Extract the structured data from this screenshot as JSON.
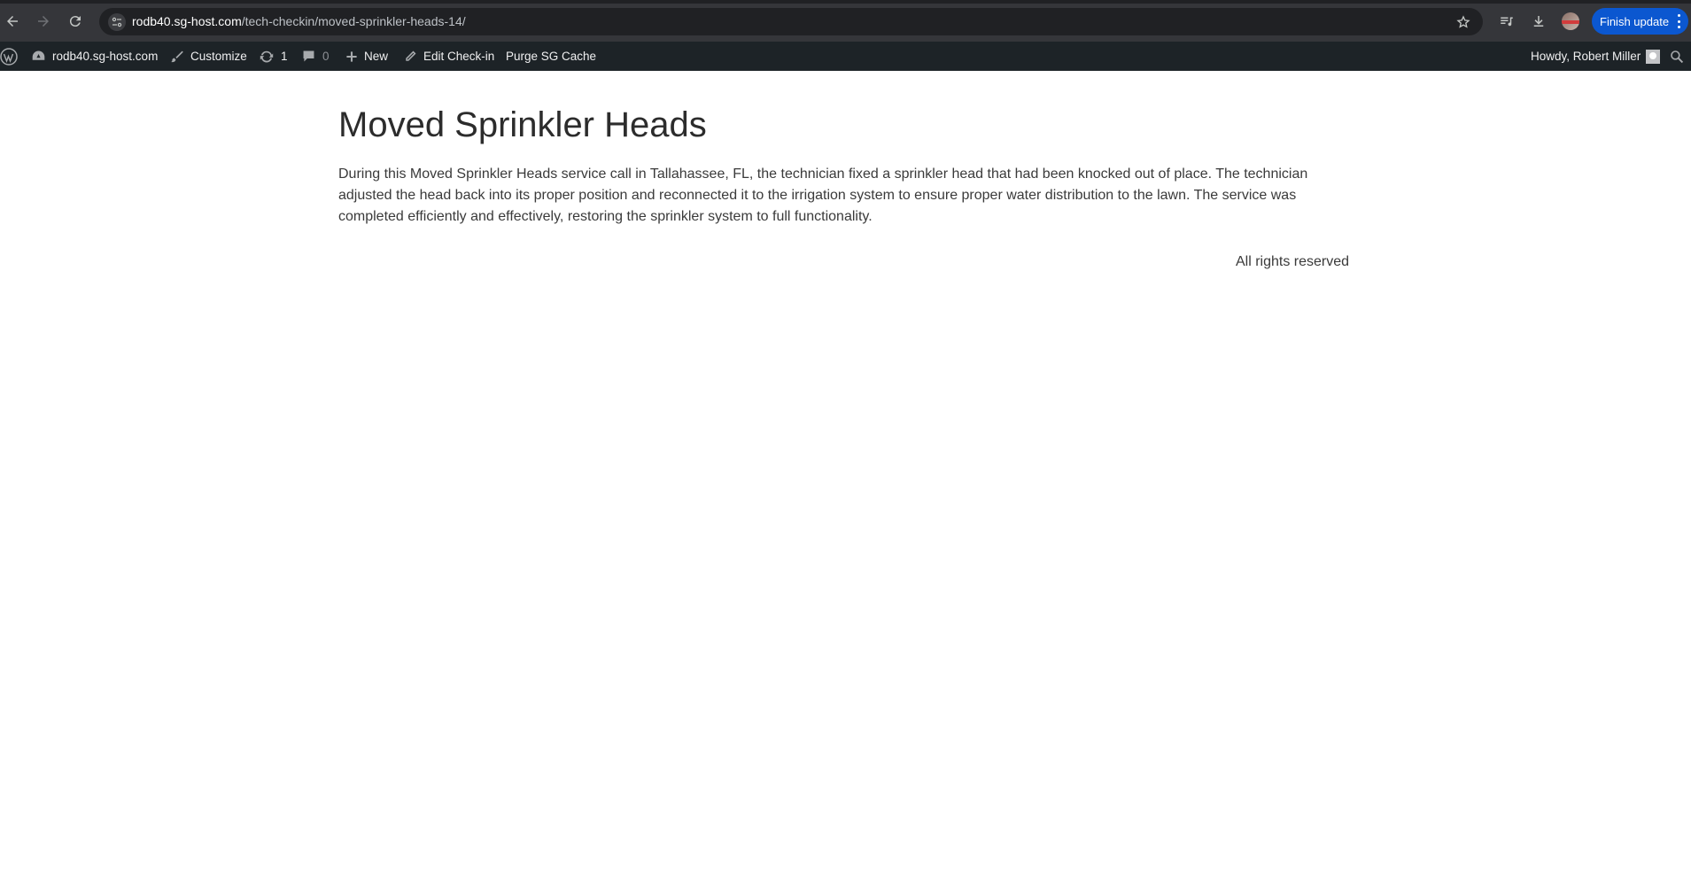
{
  "browser": {
    "url_host": "rodb40.sg-host.com",
    "url_path": "/tech-checkin/moved-sprinkler-heads-14/",
    "finish_update_label": "Finish update",
    "icons": [
      "back-icon",
      "forward-icon",
      "reload-icon",
      "site-info-icon",
      "bookmark-star-icon",
      "media-control-icon",
      "download-icon",
      "profile-avatar-icon",
      "more-menu-icon"
    ]
  },
  "admin_bar": {
    "site_name": "rodb40.sg-host.com",
    "customize": "Customize",
    "updates_count": "1",
    "comments_count": "0",
    "new_label": "New",
    "edit_label": "Edit Check-in",
    "purge_label": "Purge SG Cache",
    "howdy": "Howdy, Robert Miller"
  },
  "post": {
    "title": "Moved Sprinkler Heads",
    "body": "During this Moved Sprinkler Heads service call in Tallahassee, FL, the technician fixed a sprinkler head that had been knocked out of place. The technician adjusted the head back into its proper position and reconnected it to the irrigation system to ensure proper water distribution to the lawn. The service was completed efficiently and effectively, restoring the sprinkler system to full functionality."
  },
  "footer": {
    "text": "All rights reserved"
  },
  "colors": {
    "browser_bg": "#35363a",
    "omnibox_bg": "#202124",
    "admin_bar_bg": "#1d2327",
    "finish_button": "#0b57d0",
    "text": "#3a3a3a"
  }
}
